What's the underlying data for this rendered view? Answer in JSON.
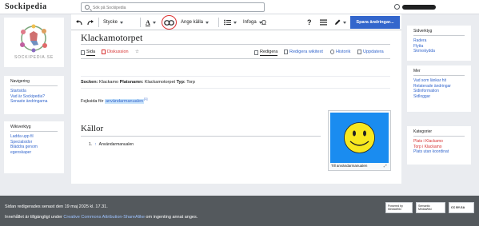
{
  "header": {
    "brand": "Sockipedia",
    "search_placeholder": "Sök på Sockipedia"
  },
  "logo": {
    "text": "SOCKIPEDIA.SE"
  },
  "left_nav": {
    "title": "Navigering",
    "items": [
      "Startsida",
      "Vad är Sockipedia?",
      "Senaste ändringarna"
    ]
  },
  "left_tools": {
    "title": "Wikiverktyg",
    "items": [
      "Ladda upp fil",
      "Specialsidor",
      "Bläddra genom egenskaper"
    ]
  },
  "toolbar": {
    "paragraph": "Stycke",
    "text_style": "A",
    "cite": "Ange källa",
    "insert": "Infoga",
    "special_char": "Ω",
    "help": "?",
    "save": "Spara ändringar..."
  },
  "page": {
    "title": "Klackamotorpet",
    "tabs": {
      "page": "Sida",
      "discussion": "Diskussion"
    },
    "actions": {
      "edit": "Redigera",
      "edit_wikitext": "Redigera wikitext",
      "history": "Historik",
      "refresh": "Uppdatera"
    },
    "info": {
      "label1": "Socken:",
      "value1": "Klackamo",
      "label2": "Platsnamn:",
      "value2": "Klackamotorpet",
      "label3": "Typ:",
      "value3": "Torp"
    },
    "body_prefix": "Fejksida för",
    "body_link": "användarmanualen",
    "footnote": "[1]",
    "section_heading": "Källor",
    "references": [
      {
        "num": "1.",
        "arrow": "↑",
        "text": "Användarmanualen"
      }
    ],
    "image_caption": "Till användarmanualen"
  },
  "right_tools": {
    "title": "Sidverktyg",
    "items": [
      "Radera",
      "Flytta",
      "Skrivskydda"
    ]
  },
  "right_more": {
    "title": "Mer",
    "items": [
      "Vad som länkar hit",
      "Relaterade ändringar",
      "Sidinformation",
      "Sidloggar"
    ]
  },
  "right_categories": {
    "title": "Kategorier",
    "items": [
      "Plats i Klackamo",
      "Torp i Klackamo",
      "Plats utan koordinat"
    ]
  },
  "footer": {
    "last_edit": "Sidan redigerades senast den 19 maj 2025 kl. 17.31.",
    "license_prefix": "Innehållet är tillgängligt under",
    "license_link": "Creative Commons Attribution-ShareAlike",
    "license_suffix": "om ingenting annat anges.",
    "badges": [
      "Powered by MediaWiki",
      "Semantic MediaWiki",
      "CC BY-SA"
    ]
  },
  "colors": {
    "accent": "#3366cc",
    "save": "#3366cc",
    "highlight": "#d33333",
    "footer": "#54595d"
  }
}
